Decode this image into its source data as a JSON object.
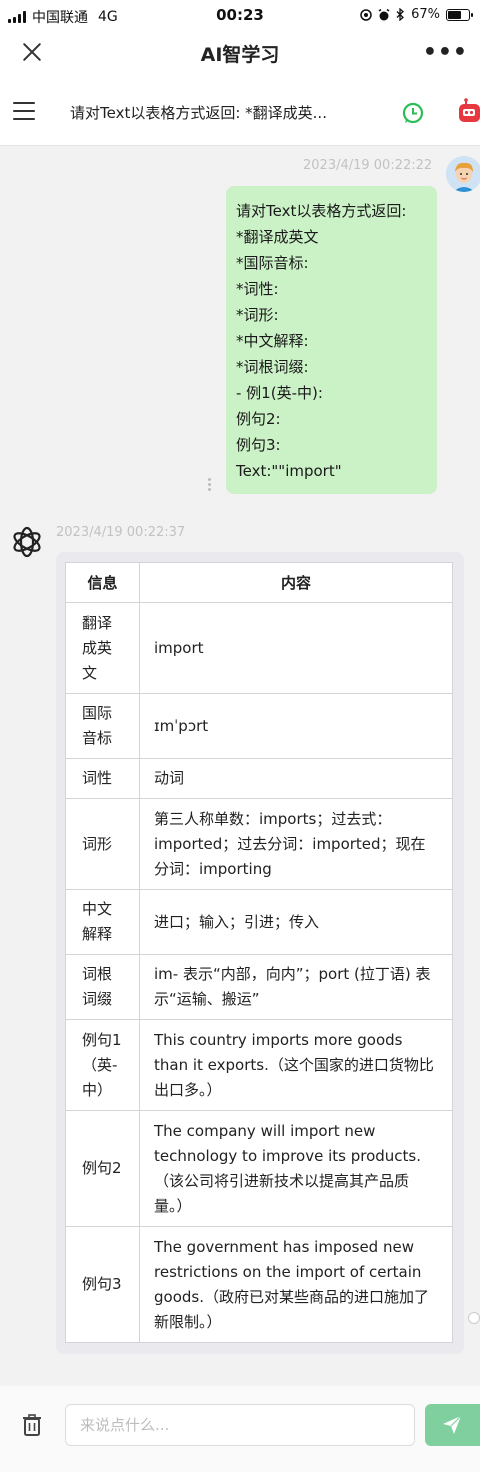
{
  "status_bar": {
    "carrier": "中国联通",
    "network": "4G",
    "time": "00:23",
    "battery_percent": "67%",
    "battery_level": 0.67
  },
  "title_bar": {
    "title": "AI智学习"
  },
  "chat_header": {
    "title": "请对Text以表格方式返回: *翻译成英..."
  },
  "user_message": {
    "timestamp": "2023/4/19 00:22:22",
    "lines": [
      "请对Text以表格方式返回:",
      "*翻译成英文",
      "*国际音标:",
      "*词性:",
      "*词形:",
      "*中文解释:",
      "*词根词缀:",
      "- 例1(英-中):",
      "例句2:",
      "例句3:",
      "Text:\"\"import\""
    ]
  },
  "ai_message": {
    "timestamp": "2023/4/19 00:22:37",
    "table": {
      "headers": [
        "信息",
        "内容"
      ],
      "rows": [
        {
          "key": "翻译成英文",
          "value": "import"
        },
        {
          "key": "国际音标",
          "value": "ɪmˈpɔrt"
        },
        {
          "key": "词性",
          "value": "动词"
        },
        {
          "key": "词形",
          "value": "第三人称单数：imports；过去式：imported；过去分词：imported；现在分词：importing"
        },
        {
          "key": "中文解释",
          "value": "进口；输入；引进；传入"
        },
        {
          "key": "词根词缀",
          "value": "im- 表示“内部，向内”；port (拉丁语) 表示“运输、搬运”"
        },
        {
          "key": "例句1（英-中）",
          "value": "This country imports more goods than it exports.（这个国家的进口货物比出口多。）"
        },
        {
          "key": "例句2",
          "value": "The company will import new technology to improve its products.（该公司将引进新技术以提高其产品质量。）"
        },
        {
          "key": "例句3",
          "value": "The government has imposed new restrictions on the import of certain goods.（政府已对某些商品的进口施加了新限制。）"
        }
      ]
    }
  },
  "input_bar": {
    "placeholder": "来说点什么..."
  },
  "colors": {
    "user_bubble": "#cbf1c6",
    "send_button": "#7fd09e",
    "whatsapp_green": "#2bbd57",
    "robot_red": "#e6383e"
  },
  "icons": [
    "signal-icon",
    "wifi-icon",
    "battery-icon",
    "close-icon",
    "more-icon",
    "menu-icon",
    "whatsapp-icon",
    "robot-icon",
    "user-avatar",
    "openai-logo-icon",
    "trash-icon",
    "send-icon"
  ]
}
